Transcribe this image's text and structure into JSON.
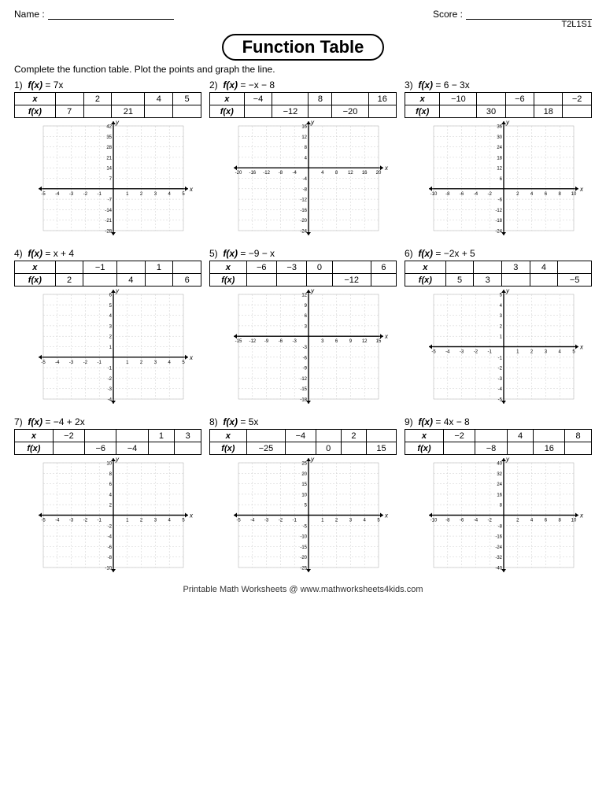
{
  "header": {
    "name_label": "Name :",
    "score_label": "Score :",
    "id_label": "T2L1S1"
  },
  "title": "Function Table",
  "instructions": "Complete the function table. Plot the points and graph the line.",
  "problems": [
    {
      "number": "1)",
      "func": "f(x) = 7x",
      "rows": [
        [
          "x",
          "",
          "2",
          "",
          "4",
          "5"
        ],
        [
          "f(x)",
          "7",
          "",
          "21",
          "",
          ""
        ]
      ],
      "graph": {
        "xmin": -5,
        "xmax": 5,
        "ymin": -28,
        "ymax": 42,
        "xstep": 1,
        "ystep": 7,
        "xlabels": [
          -5,
          -4,
          -3,
          -2,
          -1,
          1,
          2,
          3,
          4,
          5
        ],
        "ylabels": [
          42,
          35,
          28,
          21,
          14,
          7,
          -7,
          -14,
          -21,
          -28
        ]
      }
    },
    {
      "number": "2)",
      "func": "f(x) = −x − 8",
      "rows": [
        [
          "x",
          "−4",
          "",
          "8",
          "",
          "16"
        ],
        [
          "f(x)",
          "",
          "−12",
          "",
          "−20",
          ""
        ]
      ],
      "graph": {
        "xmin": -20,
        "xmax": 20,
        "ymin": -24,
        "ymax": 16,
        "xstep": 4,
        "ystep": 4,
        "xlabels": [
          -20,
          -16,
          -12,
          -8,
          -4,
          4,
          8,
          12,
          16,
          20
        ],
        "ylabels": [
          16,
          12,
          8,
          4,
          -4,
          -8,
          -12,
          -16,
          -20,
          -24
        ]
      }
    },
    {
      "number": "3)",
      "func": "f(x) = 6 − 3x",
      "rows": [
        [
          "x",
          "−10",
          "",
          "−6",
          "",
          "−2"
        ],
        [
          "f(x)",
          "",
          "30",
          "",
          "18",
          ""
        ]
      ],
      "graph": {
        "xmin": -10,
        "xmax": 10,
        "ymin": -24,
        "ymax": 36,
        "xstep": 2,
        "ystep": 6,
        "xlabels": [
          -10,
          -8,
          -6,
          -4,
          -2,
          2,
          4,
          6,
          8,
          10
        ],
        "ylabels": [
          36,
          30,
          24,
          18,
          12,
          6,
          -6,
          -12,
          -18,
          -24
        ]
      }
    },
    {
      "number": "4)",
      "func": "f(x) = x + 4",
      "rows": [
        [
          "x",
          "",
          "−1",
          "",
          "1",
          ""
        ],
        [
          "f(x)",
          "2",
          "",
          "4",
          "",
          "6"
        ]
      ],
      "graph": {
        "xmin": -5,
        "xmax": 5,
        "ymin": -4,
        "ymax": 6,
        "xstep": 1,
        "ystep": 1,
        "xlabels": [
          -5,
          -4,
          -3,
          -2,
          -1,
          1,
          2,
          3,
          4,
          5
        ],
        "ylabels": [
          6,
          5,
          4,
          3,
          2,
          1,
          -1,
          -2,
          -3,
          -4
        ]
      }
    },
    {
      "number": "5)",
      "func": "f(x) = −9 − x",
      "rows": [
        [
          "x",
          "−6",
          "−3",
          "0",
          "",
          "6"
        ],
        [
          "f(x)",
          "",
          "",
          "",
          "−12",
          ""
        ]
      ],
      "graph": {
        "xmin": -15,
        "xmax": 15,
        "ymin": -18,
        "ymax": 12,
        "xstep": 3,
        "ystep": 3,
        "xlabels": [
          -15,
          -12,
          -9,
          -6,
          -3,
          3,
          6,
          9,
          12,
          15
        ],
        "ylabels": [
          12,
          9,
          6,
          3,
          -3,
          -6,
          -9,
          -12,
          -15,
          -18
        ]
      }
    },
    {
      "number": "6)",
      "func": "f(x) = −2x + 5",
      "rows": [
        [
          "x",
          "",
          "",
          "3",
          "4",
          ""
        ],
        [
          "f(x)",
          "5",
          "3",
          "",
          "",
          "−5"
        ]
      ],
      "graph": {
        "xmin": -5,
        "xmax": 5,
        "ymin": -5,
        "ymax": 5,
        "xstep": 1,
        "ystep": 1,
        "xlabels": [
          -5,
          -4,
          -3,
          -2,
          -1,
          1,
          2,
          3,
          4,
          5
        ],
        "ylabels": [
          5,
          4,
          3,
          2,
          1,
          -1,
          -2,
          -3,
          -4,
          -5
        ]
      }
    },
    {
      "number": "7)",
      "func": "f(x) = −4 + 2x",
      "rows": [
        [
          "x",
          "−2",
          "",
          "",
          "1",
          "3"
        ],
        [
          "f(x)",
          "",
          "−6",
          "−4",
          "",
          ""
        ]
      ],
      "graph": {
        "xmin": -5,
        "xmax": 5,
        "ymin": -10,
        "ymax": 10,
        "xstep": 1,
        "ystep": 2,
        "xlabels": [
          -5,
          -4,
          -3,
          -2,
          -1,
          1,
          2,
          3,
          4,
          5
        ],
        "ylabels": [
          10,
          8,
          6,
          4,
          2,
          -2,
          -4,
          -6,
          -8,
          -10
        ]
      }
    },
    {
      "number": "8)",
      "func": "f(x) = 5x",
      "rows": [
        [
          "x",
          "",
          "−4",
          "",
          "2",
          ""
        ],
        [
          "f(x)",
          "−25",
          "",
          "0",
          "",
          "15"
        ]
      ],
      "graph": {
        "xmin": -5,
        "xmax": 5,
        "ymin": -25,
        "ymax": 25,
        "xstep": 1,
        "ystep": 5,
        "xlabels": [
          -5,
          -4,
          -3,
          -2,
          -1,
          1,
          2,
          3,
          4,
          5
        ],
        "ylabels": [
          25,
          20,
          15,
          10,
          5,
          -5,
          -10,
          -15,
          -20,
          -25
        ]
      }
    },
    {
      "number": "9)",
      "func": "f(x) = 4x − 8",
      "rows": [
        [
          "x",
          "−2",
          "",
          "4",
          "",
          "8"
        ],
        [
          "f(x)",
          "",
          "−8",
          "",
          "16",
          ""
        ]
      ],
      "graph": {
        "xmin": -10,
        "xmax": 10,
        "ymin": -40,
        "ymax": 40,
        "xstep": 2,
        "ystep": 8,
        "xlabels": [
          -10,
          -8,
          -6,
          -4,
          -2,
          2,
          4,
          6,
          8,
          10
        ],
        "ylabels": [
          40,
          32,
          24,
          16,
          8,
          -8,
          -16,
          -24,
          -32,
          -40
        ]
      }
    }
  ],
  "footer": "Printable Math Worksheets @ www.mathworksheets4kids.com"
}
